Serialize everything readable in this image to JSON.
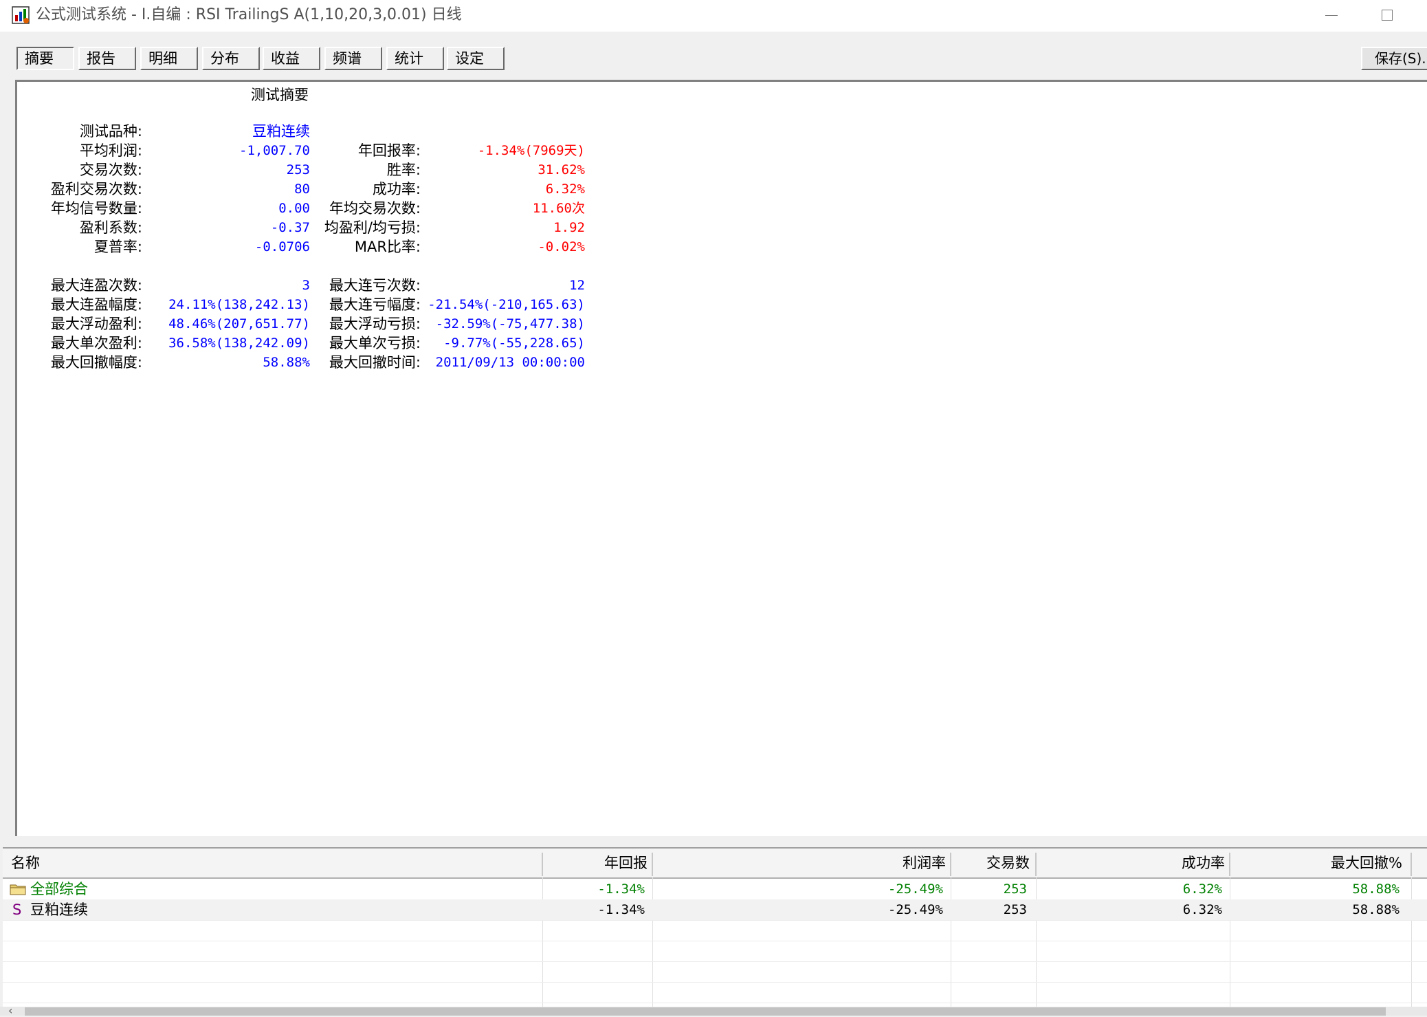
{
  "window": {
    "title": "公式测试系统 - I.自编 : RSI TrailingS A(1,10,20,3,0.01) 日线",
    "icon": "chart-app-icon"
  },
  "tabs": [
    {
      "label": "摘要",
      "active": true
    },
    {
      "label": "报告",
      "active": false
    },
    {
      "label": "明细",
      "active": false
    },
    {
      "label": "分布",
      "active": false
    },
    {
      "label": "收益",
      "active": false
    },
    {
      "label": "频谱",
      "active": false
    },
    {
      "label": "统计",
      "active": false
    },
    {
      "label": "设定",
      "active": false
    }
  ],
  "save_label": "保存(S)...",
  "summary": {
    "title": "测试摘要",
    "instrument_label": "测试品种:",
    "instrument_value": "豆粕连续",
    "left_rows": [
      {
        "label": "平均利润:",
        "value": "-1,007.70"
      },
      {
        "label": "交易次数:",
        "value": "253"
      },
      {
        "label": "盈利交易次数:",
        "value": "80"
      },
      {
        "label": "年均信号数量:",
        "value": "0.00"
      },
      {
        "label": "盈利系数:",
        "value": "-0.37"
      },
      {
        "label": "夏普率:",
        "value": "-0.0706"
      }
    ],
    "right_rows": [
      {
        "label": "年回报率:",
        "value": "-1.34%(7969天)"
      },
      {
        "label": "胜率:",
        "value": "31.62%"
      },
      {
        "label": "成功率:",
        "value": "6.32%"
      },
      {
        "label": "年均交易次数:",
        "value": "11.60次"
      },
      {
        "label": "均盈利/均亏损:",
        "value": "1.92"
      },
      {
        "label": "MAR比率:",
        "value": "-0.02%"
      }
    ],
    "left_rows2": [
      {
        "label": "最大连盈次数:",
        "value": "3"
      },
      {
        "label": "最大连盈幅度:",
        "value": "24.11%(138,242.13)"
      },
      {
        "label": "最大浮动盈利:",
        "value": "48.46%(207,651.77)"
      },
      {
        "label": "最大单次盈利:",
        "value": "36.58%(138,242.09)"
      },
      {
        "label": "最大回撤幅度:",
        "value": "58.88%"
      }
    ],
    "right_rows2": [
      {
        "label": "最大连亏次数:",
        "value": "12"
      },
      {
        "label": "最大连亏幅度:",
        "value": "-21.54%(-210,165.63)"
      },
      {
        "label": "最大浮动亏损:",
        "value": "-32.59%(-75,477.38)"
      },
      {
        "label": "最大单次亏损:",
        "value": "-9.77%(-55,228.65)"
      },
      {
        "label": "最大回撤时间:",
        "value": "2011/09/13 00:00:00"
      }
    ]
  },
  "grid": {
    "headers": [
      "名称",
      "年回报",
      "利润率",
      "交易数",
      "成功率",
      "最大回撤%"
    ],
    "rows": [
      {
        "icon": "folder-icon",
        "name": "全部综合",
        "annual": "-1.34%",
        "profit": "-25.49%",
        "trades": "253",
        "success": "6.32%",
        "drawdown": "58.88%"
      },
      {
        "icon": "strategy-s-icon",
        "name": "豆粕连续",
        "annual": "-1.34%",
        "profit": "-25.49%",
        "trades": "253",
        "success": "6.32%",
        "drawdown": "58.88%",
        "s_glyph": "S"
      }
    ]
  },
  "colors": {
    "value_blue": "#0000ff",
    "value_red": "#ff0000",
    "summary_row_green": "#008000"
  }
}
